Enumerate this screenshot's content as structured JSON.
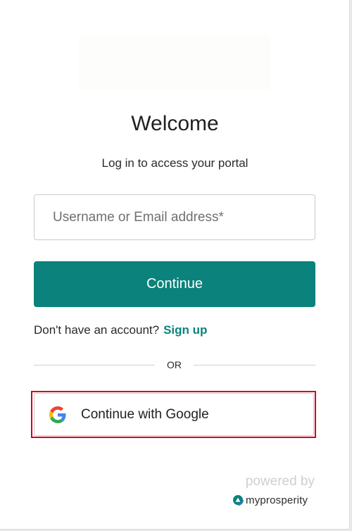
{
  "header": {
    "title": "Welcome",
    "subtitle": "Log in to access your portal"
  },
  "form": {
    "username": {
      "value": "",
      "placeholder": "Username or Email address*"
    },
    "continue_label": "Continue"
  },
  "signup": {
    "prompt": "Don't have an account?",
    "link_label": "Sign up"
  },
  "divider": {
    "label": "OR"
  },
  "social": {
    "google_label": "Continue with Google",
    "icon": "google-icon"
  },
  "footer": {
    "powered_by": "powered by",
    "brand": "myprosperity",
    "icon": "myprosperity-logo-icon"
  },
  "colors": {
    "accent": "#0b827b",
    "highlight": "#d0021b"
  }
}
